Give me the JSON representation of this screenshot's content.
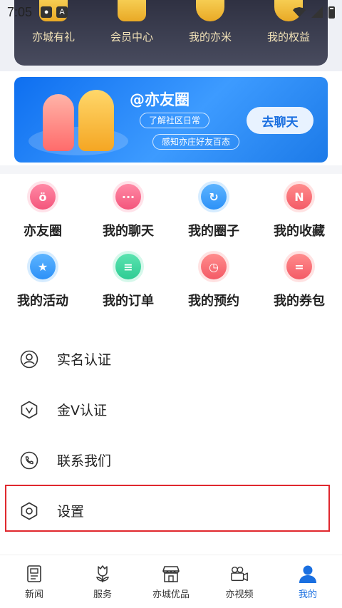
{
  "status_bar": {
    "time": "7:05",
    "app_icons": [
      "wechat-icon",
      "a-icon"
    ]
  },
  "member_card": {
    "items": [
      {
        "label": "亦城有礼",
        "icon": "gift-icon"
      },
      {
        "label": "会员中心",
        "icon": "member-icon"
      },
      {
        "label": "我的亦米",
        "icon": "coin-icon"
      },
      {
        "label": "我的权益",
        "icon": "rights-icon"
      }
    ]
  },
  "banner": {
    "title": "@亦友圈",
    "tag1": "了解社区日常",
    "tag2": "感知亦庄好友百态",
    "button": "去聊天"
  },
  "grid": {
    "items": [
      {
        "label": "亦友圈",
        "icon": "rabbit-icon",
        "color": "pink",
        "glyph": "ö"
      },
      {
        "label": "我的聊天",
        "icon": "chat-bubble-icon",
        "color": "pink",
        "glyph": "···"
      },
      {
        "label": "我的圈子",
        "icon": "circle-arrow-icon",
        "color": "blue",
        "glyph": "↻"
      },
      {
        "label": "我的收藏",
        "icon": "star-n-icon",
        "color": "red",
        "glyph": "N"
      },
      {
        "label": "我的活动",
        "icon": "badge-star-icon",
        "color": "blue",
        "glyph": "★"
      },
      {
        "label": "我的订单",
        "icon": "list-icon",
        "color": "green",
        "glyph": "≡"
      },
      {
        "label": "我的预约",
        "icon": "clock-icon",
        "color": "red",
        "glyph": "◷"
      },
      {
        "label": "我的券包",
        "icon": "ticket-icon",
        "color": "red",
        "glyph": "="
      }
    ]
  },
  "list": {
    "items": [
      {
        "label": "实名认证",
        "icon": "user-circle-icon"
      },
      {
        "label": "金V认证",
        "icon": "v-badge-icon"
      },
      {
        "label": "联系我们",
        "icon": "phone-icon"
      },
      {
        "label": "设置",
        "icon": "settings-hexagon-icon"
      }
    ]
  },
  "tabbar": {
    "items": [
      {
        "label": "新闻",
        "icon": "news-icon",
        "active": false
      },
      {
        "label": "服务",
        "icon": "tulip-icon",
        "active": false
      },
      {
        "label": "亦城优品",
        "icon": "store-icon",
        "active": false
      },
      {
        "label": "亦视频",
        "icon": "video-camera-icon",
        "active": false
      },
      {
        "label": "我的",
        "icon": "person-icon",
        "active": true
      }
    ],
    "active_color": "#1a6fe0"
  }
}
